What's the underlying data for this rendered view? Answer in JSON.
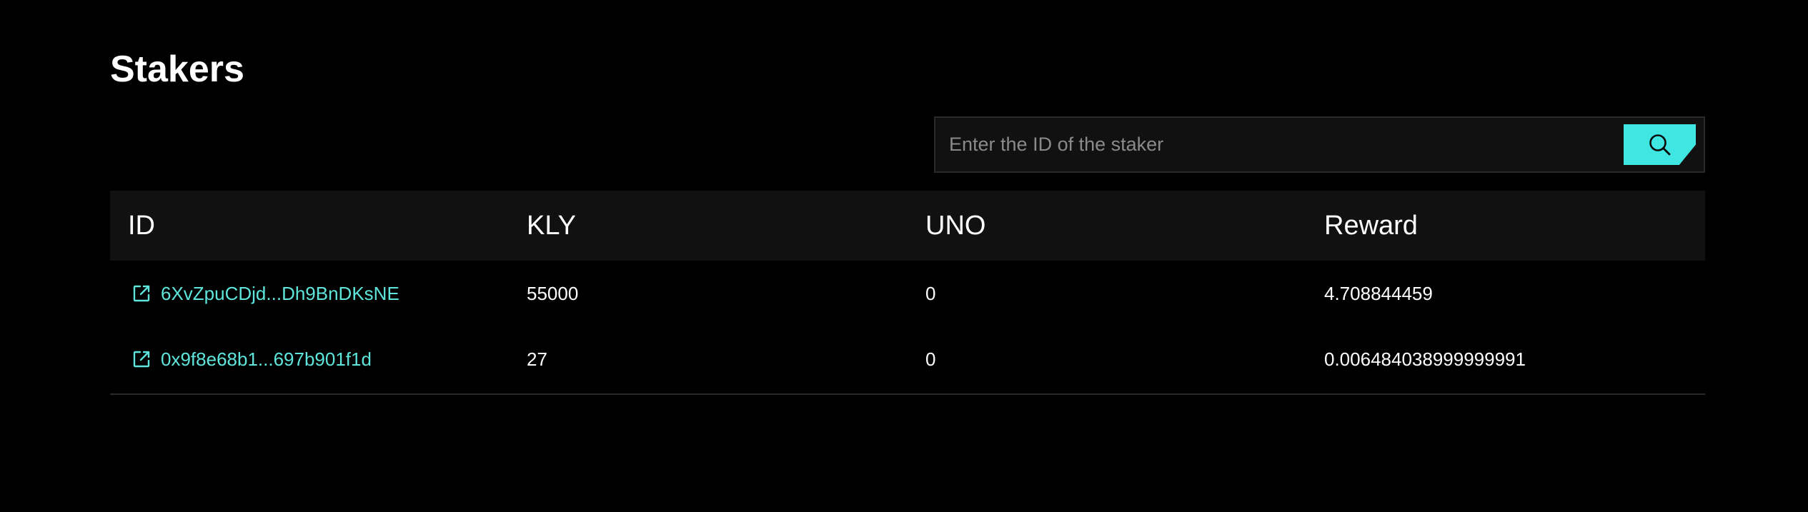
{
  "page": {
    "title": "Stakers"
  },
  "search": {
    "placeholder": "Enter the ID of the staker",
    "value": "",
    "button_icon": "search-icon"
  },
  "table": {
    "headers": {
      "id": "ID",
      "kly": "KLY",
      "uno": "UNO",
      "reward": "Reward"
    },
    "rows": [
      {
        "id": "6XvZpuCDjd...Dh9BnDKsNE",
        "kly": "55000",
        "uno": "0",
        "reward": "4.708844459",
        "icon": "external-link-icon"
      },
      {
        "id": "0x9f8e68b1...697b901f1d",
        "kly": "27",
        "uno": "0",
        "reward": "0.006484038999999991",
        "icon": "external-link-icon"
      }
    ]
  },
  "colors": {
    "background": "#000000",
    "accent": "#3fe6e2",
    "link": "#5ee6dd",
    "header_bg": "#111111"
  }
}
